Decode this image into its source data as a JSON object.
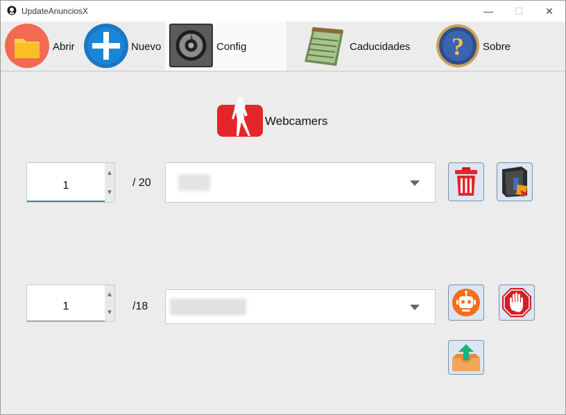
{
  "window": {
    "title": "UpdateAnunciosX",
    "minimize": "—",
    "maximize": "☐",
    "close": "✕"
  },
  "toolbar": {
    "abrir": "Abrir",
    "nuevo": "Nuevo",
    "config": "Config",
    "caducidades": "Caducidades",
    "sobre": "Sobre"
  },
  "site": {
    "label": "Webcamers"
  },
  "section1": {
    "spinner_value": "1",
    "total": "/ 20"
  },
  "section2": {
    "spinner_value": "1",
    "total": "/18"
  },
  "colors": {
    "accent": "#2a8ec0",
    "brand_red": "#e3262c",
    "orange": "#f46d1a",
    "selected_tab": "#fafafa"
  }
}
